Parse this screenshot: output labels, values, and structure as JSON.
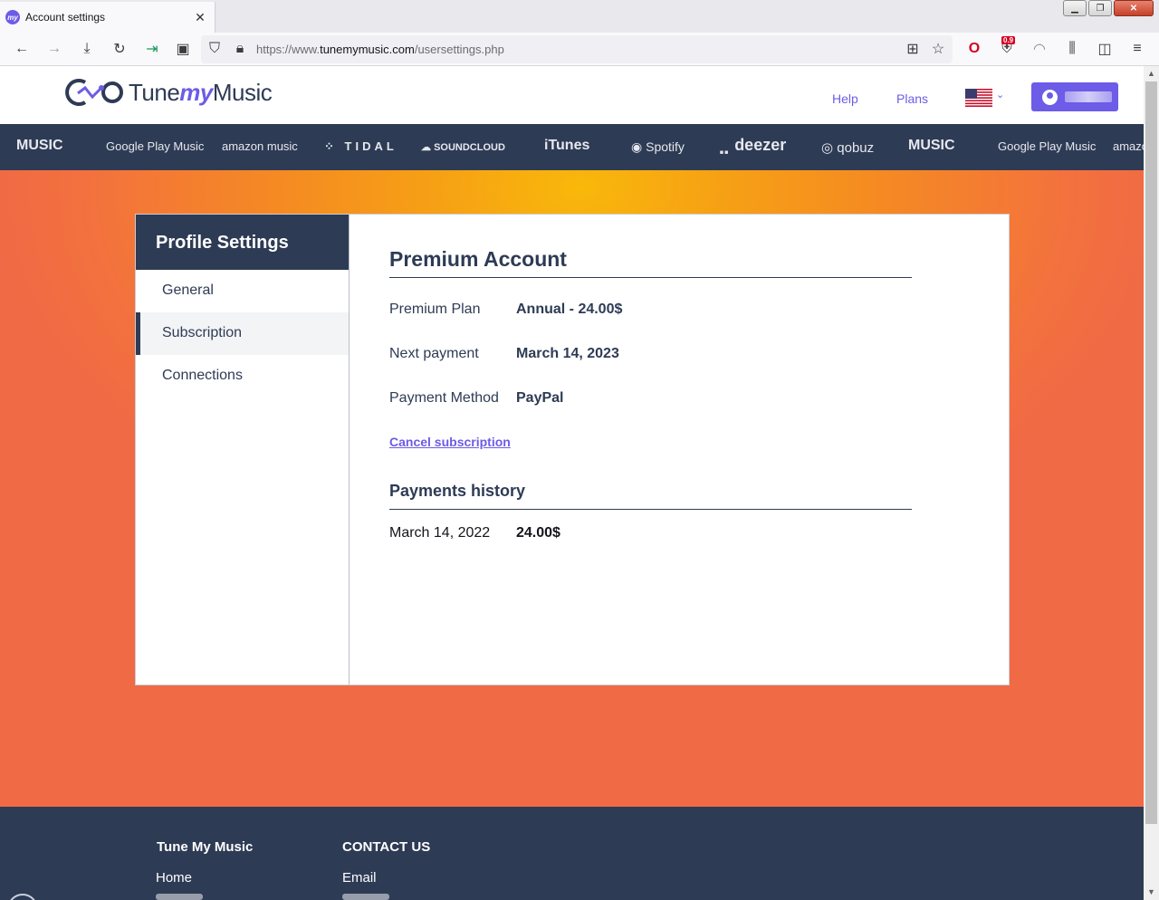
{
  "browser": {
    "tab_title": "Account settings",
    "tab_favicon_text": "my",
    "url_prefix": "https://www.",
    "url_domain": "tunemymusic.com",
    "url_path": "/usersettings.php",
    "shield_badge": "0.9"
  },
  "site": {
    "logo_tune": "Tune",
    "logo_my": "my",
    "logo_music": "Music",
    "nav_help": "Help",
    "nav_plans": "Plans"
  },
  "services": [
    "MUSIC",
    "Google Play Music",
    "amazon music",
    "TIDAL",
    "SOUNDCLOUD",
    "iTunes",
    "Spotify",
    "deezer",
    "qobuz",
    "MUSIC",
    "Google Play Music",
    "amazo"
  ],
  "sidebar": {
    "title": "Profile Settings",
    "items": [
      {
        "label": "General"
      },
      {
        "label": "Subscription"
      },
      {
        "label": "Connections"
      }
    ]
  },
  "premium": {
    "title": "Premium Account",
    "rows": [
      {
        "label": "Premium Plan",
        "value": "Annual - 24.00$"
      },
      {
        "label": "Next payment",
        "value": "March 14, 2023"
      },
      {
        "label": "Payment Method",
        "value": "PayPal"
      }
    ],
    "cancel_label": "Cancel subscription"
  },
  "history": {
    "title": "Payments history",
    "rows": [
      {
        "date": "March 14, 2022",
        "amount": "24.00$"
      }
    ]
  },
  "footer": {
    "col1_title": "Tune My Music",
    "col1_link": "Home",
    "col2_title": "CONTACT US",
    "col2_link": "Email"
  },
  "colors": {
    "brand_purple": "#6c5ce7",
    "navy": "#2e3b55",
    "hero_orange": "#f58b22",
    "hero_yellow": "#f9b80a"
  }
}
